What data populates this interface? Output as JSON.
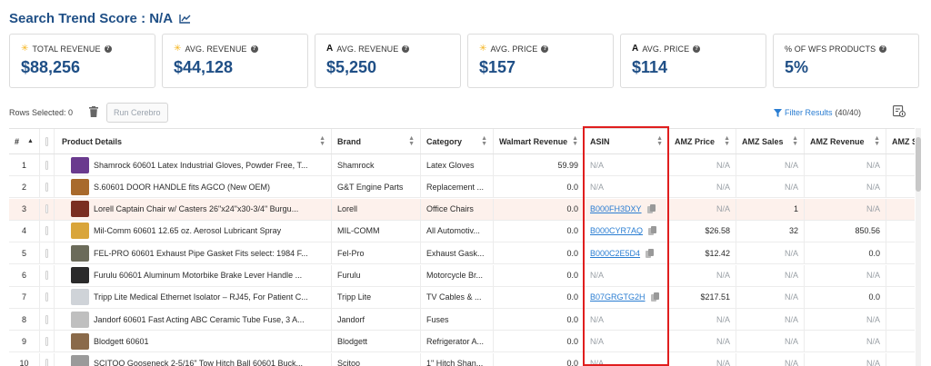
{
  "header": {
    "title": "Search Trend Score : N/A",
    "icon": "line-chart-icon"
  },
  "cards": [
    {
      "icon": "walmart-spark-icon",
      "label": "TOTAL REVENUE",
      "value": "$88,256"
    },
    {
      "icon": "walmart-spark-icon",
      "label": "AVG. REVENUE",
      "value": "$44,128"
    },
    {
      "icon": "amazon-icon",
      "label": "AVG. REVENUE",
      "value": "$5,250"
    },
    {
      "icon": "walmart-spark-icon",
      "label": "AVG. PRICE",
      "value": "$157"
    },
    {
      "icon": "amazon-icon",
      "label": "AVG. PRICE",
      "value": "$114"
    },
    {
      "icon": "",
      "label": "% OF WFS PRODUCTS",
      "value": "5%"
    }
  ],
  "toolbar": {
    "rows_selected": "Rows Selected: 0",
    "run_button": "Run Cerebro",
    "filter_label": "Filter Results",
    "filter_count": "(40/40)"
  },
  "table": {
    "headers": [
      "#",
      "Product Details",
      "Brand",
      "Category",
      "Walmart Revenue",
      "ASIN",
      "AMZ Price",
      "AMZ Sales",
      "AMZ Revenue",
      "AMZ S"
    ],
    "rows": [
      {
        "n": "1",
        "name": "Shamrock 60601 Latex Industrial Gloves, Powder Free, T...",
        "brand": "Shamrock",
        "category": "Latex Gloves",
        "wrev": "59.99",
        "asin": "N/A",
        "price": "N/A",
        "sales": "N/A",
        "arev": "N/A",
        "thumb": "#6a3a8e"
      },
      {
        "n": "2",
        "name": "S.60601 DOOR HANDLE fits AGCO (New OEM)",
        "brand": "G&T Engine Parts",
        "category": "Replacement ...",
        "wrev": "0.0",
        "asin": "N/A",
        "price": "N/A",
        "sales": "N/A",
        "arev": "N/A",
        "thumb": "#a86a2c"
      },
      {
        "n": "3",
        "name": "Lorell Captain Chair w/ Casters 26\"x24\"x30-3/4\" Burgu...",
        "brand": "Lorell",
        "category": "Office Chairs",
        "wrev": "0.0",
        "asin": "B000FH3DXY",
        "price": "N/A",
        "sales": "1",
        "arev": "N/A",
        "thumb": "#7a2e22"
      },
      {
        "n": "4",
        "name": "Mil-Comm 60601 12.65 oz. Aerosol Lubricant Spray",
        "brand": "MIL-COMM",
        "category": "All Automotiv...",
        "wrev": "0.0",
        "asin": "B000CYR7AQ",
        "price": "$26.58",
        "sales": "32",
        "arev": "850.56",
        "thumb": "#d9a53a"
      },
      {
        "n": "5",
        "name": "FEL-PRO 60601 Exhaust Pipe Gasket Fits select: 1984 F...",
        "brand": "Fel-Pro",
        "category": "Exhaust Gask...",
        "wrev": "0.0",
        "asin": "B000C2E5D4",
        "price": "$12.42",
        "sales": "N/A",
        "arev": "0.0",
        "thumb": "#6b6b5a"
      },
      {
        "n": "6",
        "name": "Furulu 60601 Aluminum Motorbike Brake Lever Handle ...",
        "brand": "Furulu",
        "category": "Motorcycle Br...",
        "wrev": "0.0",
        "asin": "N/A",
        "price": "N/A",
        "sales": "N/A",
        "arev": "N/A",
        "thumb": "#2a2a2a"
      },
      {
        "n": "7",
        "name": "Tripp Lite Medical Ethernet Isolator – RJ45, For Patient C...",
        "brand": "Tripp Lite",
        "category": "TV Cables & ...",
        "wrev": "0.0",
        "asin": "B07GRGTG2H",
        "price": "$217.51",
        "sales": "N/A",
        "arev": "0.0",
        "thumb": "#cfd3d8"
      },
      {
        "n": "8",
        "name": "Jandorf 60601 Fast Acting ABC Ceramic Tube Fuse, 3 A...",
        "brand": "Jandorf",
        "category": "Fuses",
        "wrev": "0.0",
        "asin": "N/A",
        "price": "N/A",
        "sales": "N/A",
        "arev": "N/A",
        "thumb": "#bfbfbf"
      },
      {
        "n": "9",
        "name": "Blodgett 60601",
        "brand": "Blodgett",
        "category": "Refrigerator A...",
        "wrev": "0.0",
        "asin": "N/A",
        "price": "N/A",
        "sales": "N/A",
        "arev": "N/A",
        "thumb": "#8a6a4a"
      },
      {
        "n": "10",
        "name": "SCITOO Gooseneck 2-5/16\" Tow Hitch Ball 60601 Buck...",
        "brand": "Scitoo",
        "category": "1\" Hitch Shan...",
        "wrev": "0.0",
        "asin": "N/A",
        "price": "N/A",
        "sales": "N/A",
        "arev": "N/A",
        "thumb": "#9a9a9a"
      }
    ]
  },
  "colors": {
    "accent": "#1f4f86",
    "link": "#2a7dd2",
    "highlight_row": "#fdf1ec",
    "asin_box": "#e01e1e"
  }
}
